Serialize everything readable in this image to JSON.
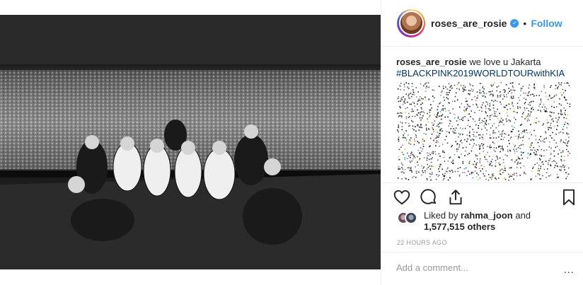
{
  "post": {
    "username": "roses_are_rosie",
    "verified_icon": "verified-badge-icon",
    "separator": "•",
    "follow_label": "Follow",
    "caption_user": "roses_are_rosie",
    "caption_text": " we love u Jakarta",
    "hashtag": "#BLACKPINK2019WORLDTOURwithKIA",
    "liked_by_prefix": "Liked by ",
    "liked_by_user": "rahma_joon",
    "liked_by_and": " and",
    "likes_count": "1,577,515 others",
    "time": "22 HOURS AGO",
    "comment_placeholder": "Add a comment...",
    "more_label": "..."
  },
  "icons": {
    "like": "heart-icon",
    "comment": "comment-icon",
    "share": "share-icon",
    "save": "bookmark-icon"
  },
  "colors": {
    "accent": "#3897f0",
    "text": "#262626",
    "muted": "#999999",
    "hashtag": "#003569",
    "divider": "#efefef"
  }
}
